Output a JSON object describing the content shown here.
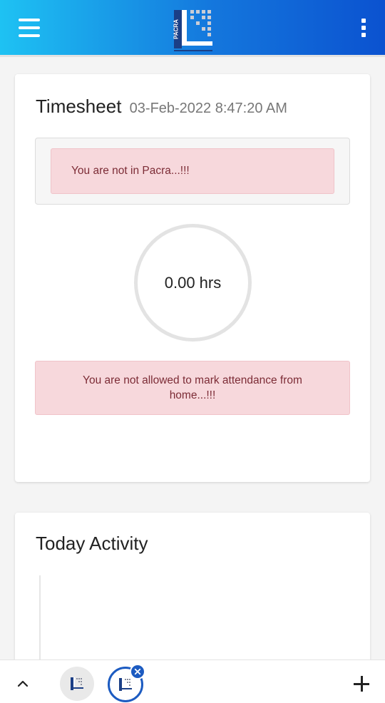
{
  "header": {
    "logo_text": "PACRA",
    "menu_icon": "hamburger-menu-icon",
    "more_icon": "more-vertical-icon"
  },
  "timesheet": {
    "title": "Timesheet",
    "timestamp": "03-Feb-2022 8:47:20 AM",
    "location_alert": "You are not in Pacra...!!!",
    "hours": "0.00 hrs",
    "home_alert": "You are not allowed to mark attendance from home...!!!"
  },
  "activity": {
    "title": "Today Activity"
  },
  "bottom_bar": {
    "collapse_icon": "chevron-up-icon",
    "tabs": [
      {
        "icon": "pacra-app-icon",
        "active": false
      },
      {
        "icon": "pacra-app-icon",
        "active": true
      }
    ],
    "close_icon": "close-icon",
    "add_icon": "plus-icon"
  },
  "colors": {
    "header_gradient_start": "#1ec2f3",
    "header_gradient_end": "#0b52d0",
    "alert_background": "#f7d8dc",
    "alert_text": "#7c2c36",
    "accent_blue": "#1c5bc1"
  }
}
